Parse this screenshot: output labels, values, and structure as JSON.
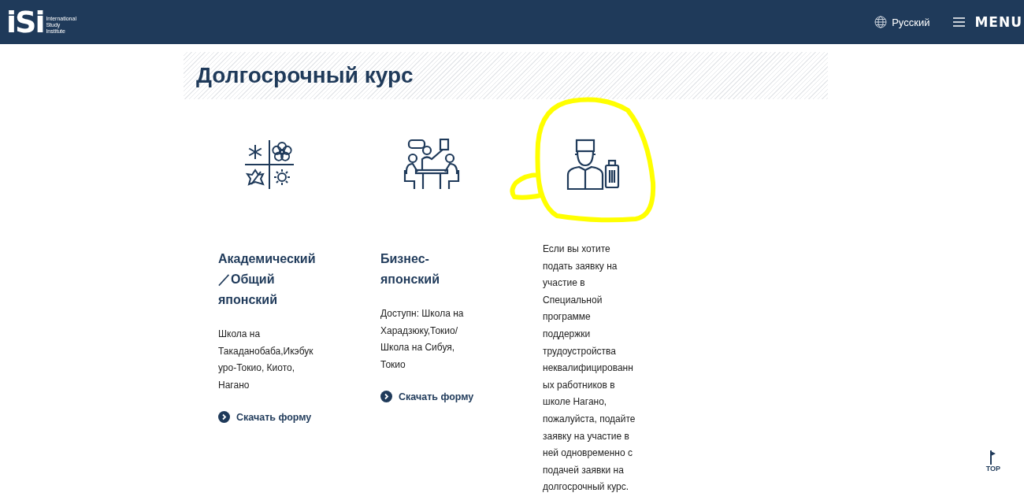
{
  "header": {
    "logo_text": [
      "International",
      "Study",
      "Institute"
    ],
    "logo_mark": "iSi",
    "language": "Русский",
    "menu": "MENU"
  },
  "section_title": "Долгосрочный курс",
  "courses": [
    {
      "kind": "course",
      "title_lines": [
        "Академический",
        "／Общий",
        "японский"
      ],
      "description_lines": [
        "Школа на",
        "Такаданобаба,Икэбук",
        "уро-Токио, Киото,",
        "Нагано"
      ],
      "link": "Скачать форму"
    },
    {
      "kind": "course",
      "title_lines": [
        "Бизнес-",
        "японский"
      ],
      "description_lines": [
        "Доступн: Школа на",
        "Харадзюку,Токио/",
        "Школа на Сибуя,",
        "Токио"
      ],
      "link": "Скачать форму"
    },
    {
      "kind": "note",
      "highlighted": true,
      "description_lines": [
        "Если вы хотите",
        "подать заявку на",
        "участие в",
        "Специальной",
        "программе",
        "поддержки",
        "трудоустройства",
        "неквалифицированн",
        "ых работников в",
        "школе Нагано,",
        "пожалуйста, подайте",
        "заявку на участие в",
        "ней одновременно с",
        "подачей заявки на",
        "долгосрочный курс."
      ]
    }
  ],
  "top_button": "TOP"
}
